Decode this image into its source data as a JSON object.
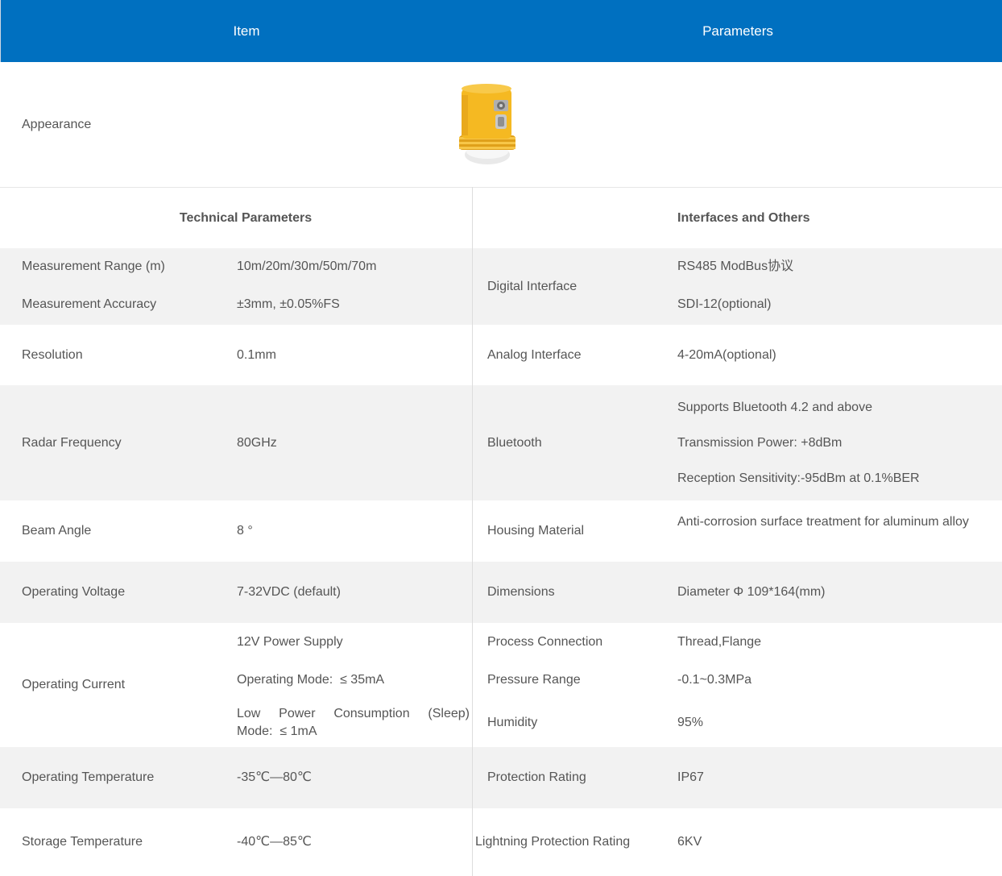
{
  "header": {
    "item": "Item",
    "parameters": "Parameters"
  },
  "appearance": {
    "label": "Appearance",
    "image_icon": "radar-level-sensor-icon"
  },
  "sections": {
    "left": "Technical Parameters",
    "right": "Interfaces and Others"
  },
  "tech": {
    "range_label": "Measurement Range (m)",
    "range_value": "10m/20m/30m/50m/70m",
    "accuracy_label": "Measurement Accuracy",
    "accuracy_value": "±3mm, ±0.05%FS",
    "resolution_label": "Resolution",
    "resolution_value": "0.1mm",
    "frequency_label": "Radar Frequency",
    "frequency_value": "80GHz",
    "beam_label": "Beam Angle",
    "beam_value": "8 °",
    "voltage_label": "Operating Voltage",
    "voltage_value": "7-32VDC (default)",
    "current_label": "Operating Current",
    "current_lines": [
      "12V Power Supply",
      "Operating Mode:  ≤ 35mA",
      "Low Power Consumption (Sleep)",
      "Mode:  ≤ 1mA"
    ],
    "op_temp_label": "Operating Temperature",
    "op_temp_value": "-35℃—80℃",
    "storage_temp_label": "Storage Temperature",
    "storage_temp_value": "-40℃—85℃"
  },
  "iface": {
    "digital_label": "Digital Interface",
    "digital_values": [
      "RS485 ModBus协议",
      "SDI-12(optional)"
    ],
    "analog_label": "Analog Interface",
    "analog_value": "4-20mA(optional)",
    "bluetooth_label": "Bluetooth",
    "bluetooth_values": [
      "Supports Bluetooth 4.2 and above",
      "Transmission Power: +8dBm",
      "Reception Sensitivity:-95dBm at 0.1%BER"
    ],
    "housing_label": "Housing Material",
    "housing_value": "Anti-corrosion surface treatment for aluminum alloy",
    "dimensions_label": "Dimensions",
    "dimensions_value": "Diameter Φ 109*164(mm)",
    "process_label": "Process Connection",
    "process_value": "Thread,Flange",
    "pressure_label": "Pressure Range",
    "pressure_value": "-0.1~0.3MPa",
    "humidity_label": "Humidity",
    "humidity_value": "95%",
    "protection_label": "Protection Rating",
    "protection_value": "IP67",
    "lightning_label": "Lightning Protection Rating",
    "lightning_value": "6KV"
  },
  "colors": {
    "header_bg": "#0070c0",
    "row_alt": "#f2f2f2",
    "product_body": "#f5b922"
  }
}
